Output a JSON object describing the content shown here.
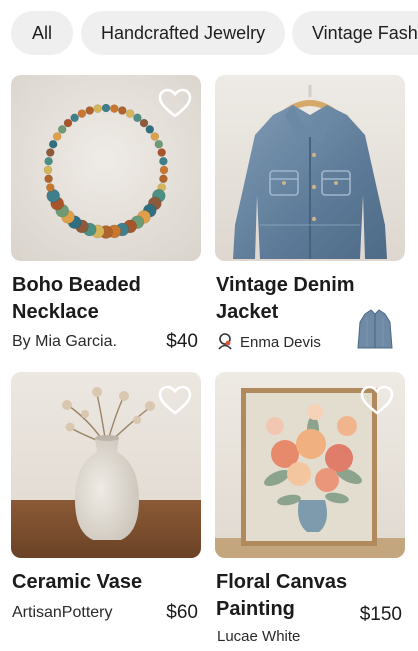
{
  "filters": {
    "all": "All",
    "jewelry": "Handcrafted Jewelry",
    "vintage": "Vintage Fashion"
  },
  "products": [
    {
      "title_line1": "Boho Beaded",
      "title_line2": "Necklace",
      "seller": "By Mia Garcia.",
      "price": "$40",
      "favorited": false
    },
    {
      "title_line1": "Vintage Denim",
      "title_line2": "Jacket",
      "seller": "Enma Devis",
      "price": "",
      "favorited": false
    },
    {
      "title_line1": "Ceramic Vase",
      "title_line2": "",
      "seller": "ArtisanPottery",
      "price": "$60",
      "favorited": false
    },
    {
      "title_line1": "Floral Canvas",
      "title_line2": "Painting",
      "seller": "Lucae White",
      "price": "$150",
      "favorited": false
    }
  ],
  "icons": {
    "favorite": "heart-outline-icon",
    "seller_avatar": "user-avatar-icon"
  }
}
